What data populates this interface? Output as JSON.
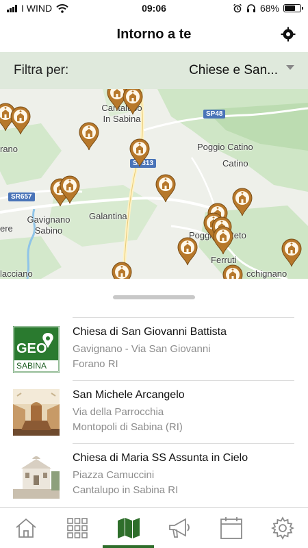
{
  "status_bar": {
    "carrier": "I WIND",
    "time": "09:06",
    "battery": "68%",
    "battery_level": 0.68
  },
  "header": {
    "title": "Intorno a te",
    "locate_icon": "crosshair-icon"
  },
  "filter": {
    "label": "Filtra per:",
    "selected": "Chiese e San..."
  },
  "map": {
    "places": {
      "cantalupo": "Cantalupo\nIn Sabina",
      "poggio_catino": "Poggio Catino",
      "catino": "Catino",
      "gavignano": "Gavignano\nSabino",
      "galantina": "Galantina",
      "poggio_mirteto": "Poggio Mirteto",
      "ferruti": "Ferruti",
      "rano": "rano",
      "lacciano": "lacciano",
      "cchignano": "cchignano",
      "ere": "ere"
    },
    "roads": {
      "sp48": "SP48",
      "sp313": "SP313",
      "sr657": "SR657"
    },
    "pin_color": "#b7782b"
  },
  "list": {
    "items": [
      {
        "title": "Chiesa di San Giovanni Battista",
        "line1": "Gavignano - Via San Giovanni",
        "line2": "Forano RI",
        "logo_text_top": "GEO",
        "logo_text_bottom": "SABINA"
      },
      {
        "title": "San Michele Arcangelo",
        "line1": "Via della Parrocchia",
        "line2": "Montopoli di Sabina (RI)"
      },
      {
        "title": "Chiesa di Maria SS Assunta in Cielo",
        "line1": "Piazza Camuccini",
        "line2": "Cantalupo in Sabina RI"
      }
    ]
  },
  "tabbar": {
    "active_color": "#2e6e2b",
    "tabs": [
      {
        "name": "home",
        "icon": "home-icon"
      },
      {
        "name": "grid",
        "icon": "grid-icon"
      },
      {
        "name": "map",
        "icon": "map-icon",
        "active": true
      },
      {
        "name": "announcements",
        "icon": "megaphone-icon"
      },
      {
        "name": "calendar",
        "icon": "calendar-icon"
      },
      {
        "name": "settings",
        "icon": "gear-icon"
      }
    ]
  }
}
